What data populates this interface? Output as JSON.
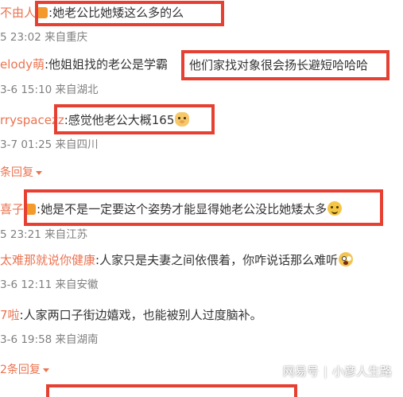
{
  "comments": [
    {
      "user": "不由人",
      "text": ":她老公比她矮这么多的么",
      "meta": "5 23:02 来自重庆"
    },
    {
      "user": "elody萌",
      "text": ":他姐姐找的老公是学霸",
      "highlight": "他们家找对象很会扬长避短哈哈哈",
      "meta": "3-6 15:10 来自湖北"
    },
    {
      "user": "rryspacez",
      "user_tail": "z",
      "text": ":感觉他老公大概165",
      "meta": "3-7 01:25 来自四川"
    },
    {
      "user": "喜子",
      "text": ":她是不是一定要这个姿势才能显得她老公没比她矮太多",
      "meta": "5 23:21 来自江苏"
    },
    {
      "user": "太难那就说你健康",
      "text": ":人家只是夫妻之间依偎着，你咋说话那么难听",
      "meta": "3-6 12:11 来自安徽"
    },
    {
      "user": "7啦",
      "text": ":人家两口子街边嬉戏，也能被别人过度脑补。",
      "meta": "3-6 19:58 来自湖南"
    }
  ],
  "replies_1": "条回复",
  "replies_2": "2条回复",
  "watermark": {
    "platform": "网易号",
    "separator": "|",
    "author": "小彦人生路"
  },
  "colors": {
    "username": "#eb7350",
    "highlight_border": "#e64032",
    "meta": "#808080"
  },
  "emojis": [
    "bear-emoji",
    "happy-emoji",
    "shock-emoji",
    "reaction-emoji"
  ]
}
